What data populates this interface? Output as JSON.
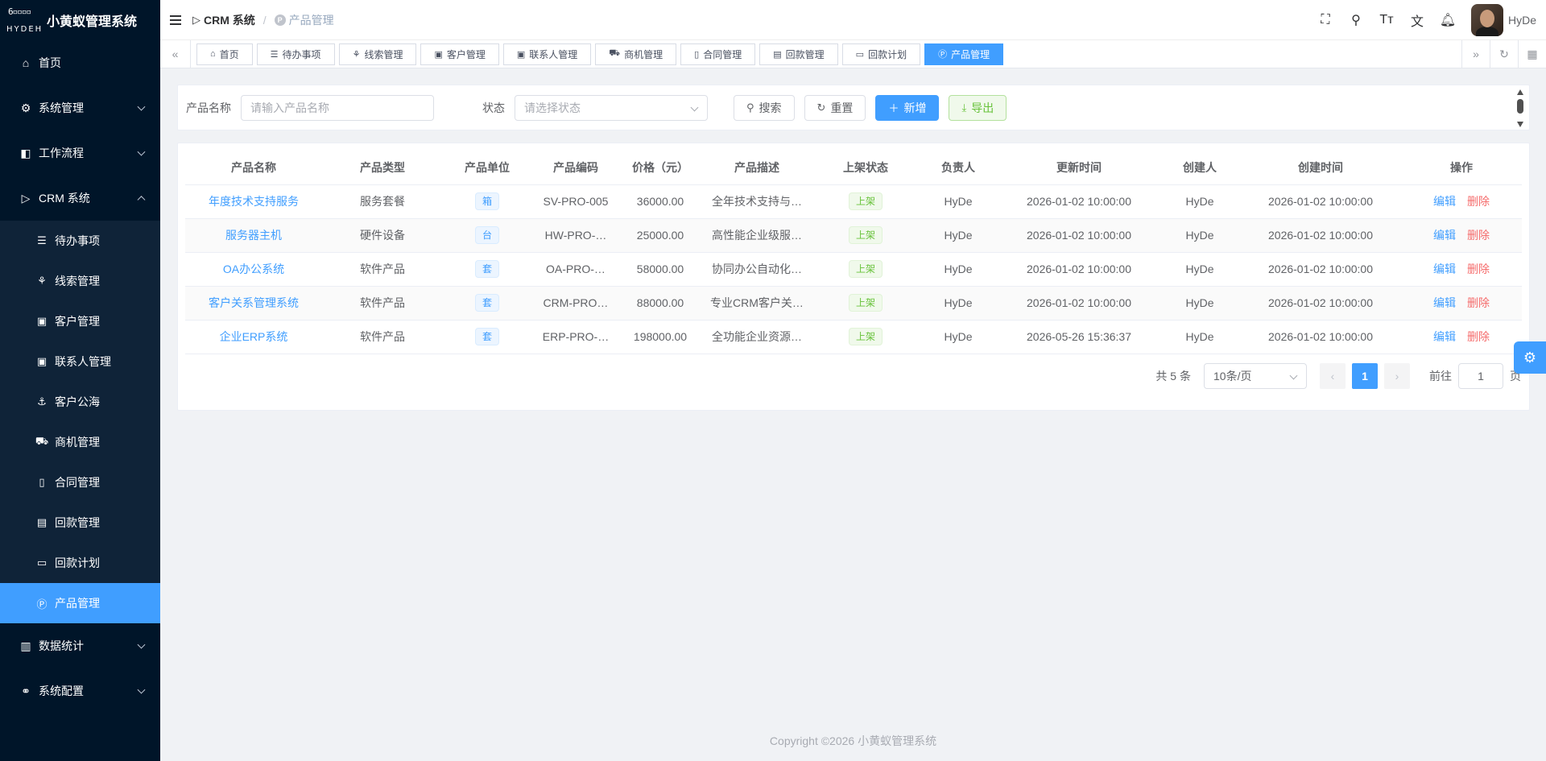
{
  "app": {
    "title": "小黄蚁管理系统",
    "logo_text": "HYDEH"
  },
  "sidebar": {
    "items": [
      {
        "label": "首页",
        "icon": "home-icon",
        "glyph": "⌂"
      },
      {
        "label": "系统管理",
        "icon": "gear-icon",
        "glyph": "⚙"
      },
      {
        "label": "工作流程",
        "icon": "flow-icon",
        "glyph": "◧"
      },
      {
        "label": "CRM 系统",
        "icon": "crm-icon",
        "glyph": "▷"
      }
    ],
    "crm_sub": [
      {
        "label": "待办事项",
        "glyph": "☰"
      },
      {
        "label": "线索管理",
        "glyph": "⚘"
      },
      {
        "label": "客户管理",
        "glyph": "▣"
      },
      {
        "label": "联系人管理",
        "glyph": "▣"
      },
      {
        "label": "客户公海",
        "glyph": "⚓"
      },
      {
        "label": "商机管理",
        "glyph": "⛟"
      },
      {
        "label": "合同管理",
        "glyph": "▯"
      },
      {
        "label": "回款管理",
        "glyph": "▤"
      },
      {
        "label": "回款计划",
        "glyph": "▭"
      },
      {
        "label": "产品管理",
        "glyph": "Ⓟ"
      }
    ],
    "after": [
      {
        "label": "数据统计",
        "glyph": "▥"
      },
      {
        "label": "系统配置",
        "glyph": "⚭"
      }
    ]
  },
  "header": {
    "breadcrumb_root": "CRM 系统",
    "breadcrumb_current": "产品管理",
    "username": "HyDe"
  },
  "tabs": [
    {
      "label": "首页",
      "glyph": "⌂"
    },
    {
      "label": "待办事项",
      "glyph": "☰"
    },
    {
      "label": "线索管理",
      "glyph": "⚘"
    },
    {
      "label": "客户管理",
      "glyph": "▣"
    },
    {
      "label": "联系人管理",
      "glyph": "▣"
    },
    {
      "label": "商机管理",
      "glyph": "⛟"
    },
    {
      "label": "合同管理",
      "glyph": "▯"
    },
    {
      "label": "回款管理",
      "glyph": "▤"
    },
    {
      "label": "回款计划",
      "glyph": "▭"
    },
    {
      "label": "产品管理",
      "glyph": "Ⓟ"
    }
  ],
  "search": {
    "name_label": "产品名称",
    "name_placeholder": "请输入产品名称",
    "status_label": "状态",
    "status_placeholder": "请选择状态",
    "search_btn": "搜索",
    "reset_btn": "重置",
    "add_btn": "新增",
    "export_btn": "导出"
  },
  "table": {
    "columns": [
      "产品名称",
      "产品类型",
      "产品单位",
      "产品编码",
      "价格（元）",
      "产品描述",
      "上架状态",
      "负责人",
      "更新时间",
      "创建人",
      "创建时间",
      "操作"
    ],
    "rows": [
      {
        "name": "年度技术支持服务",
        "type": "服务套餐",
        "unit": "箱",
        "code": "SV-PRO-005",
        "price": "36000.00",
        "desc": "全年技术支持与…",
        "status": "上架",
        "owner": "HyDe",
        "updated": "2026-01-02 10:00:00",
        "creator": "HyDe",
        "created": "2026-01-02 10:00:00"
      },
      {
        "name": "服务器主机",
        "type": "硬件设备",
        "unit": "台",
        "code": "HW-PRO-…",
        "price": "25000.00",
        "desc": "高性能企业级服…",
        "status": "上架",
        "owner": "HyDe",
        "updated": "2026-01-02 10:00:00",
        "creator": "HyDe",
        "created": "2026-01-02 10:00:00"
      },
      {
        "name": "OA办公系统",
        "type": "软件产品",
        "unit": "套",
        "code": "OA-PRO-…",
        "price": "58000.00",
        "desc": "协同办公自动化…",
        "status": "上架",
        "owner": "HyDe",
        "updated": "2026-01-02 10:00:00",
        "creator": "HyDe",
        "created": "2026-01-02 10:00:00"
      },
      {
        "name": "客户关系管理系统",
        "type": "软件产品",
        "unit": "套",
        "code": "CRM-PRO…",
        "price": "88000.00",
        "desc": "专业CRM客户关…",
        "status": "上架",
        "owner": "HyDe",
        "updated": "2026-01-02 10:00:00",
        "creator": "HyDe",
        "created": "2026-01-02 10:00:00"
      },
      {
        "name": "企业ERP系统",
        "type": "软件产品",
        "unit": "套",
        "code": "ERP-PRO-…",
        "price": "198000.00",
        "desc": "全功能企业资源…",
        "status": "上架",
        "owner": "HyDe",
        "updated": "2026-05-26 15:36:37",
        "creator": "HyDe",
        "created": "2026-01-02 10:00:00"
      }
    ],
    "edit_label": "编辑",
    "delete_label": "删除"
  },
  "pagination": {
    "total_text": "共 5 条",
    "page_size": "10条/页",
    "current_page": "1",
    "goto_label": "前往",
    "goto_value": "1",
    "page_suffix": "页"
  },
  "footer": {
    "copyright": "Copyright ©2026 小黄蚁管理系统"
  },
  "colors": {
    "primary": "#409eff",
    "sidebar_bg": "#001529",
    "danger": "#f56c6c",
    "success": "#67c23a"
  }
}
